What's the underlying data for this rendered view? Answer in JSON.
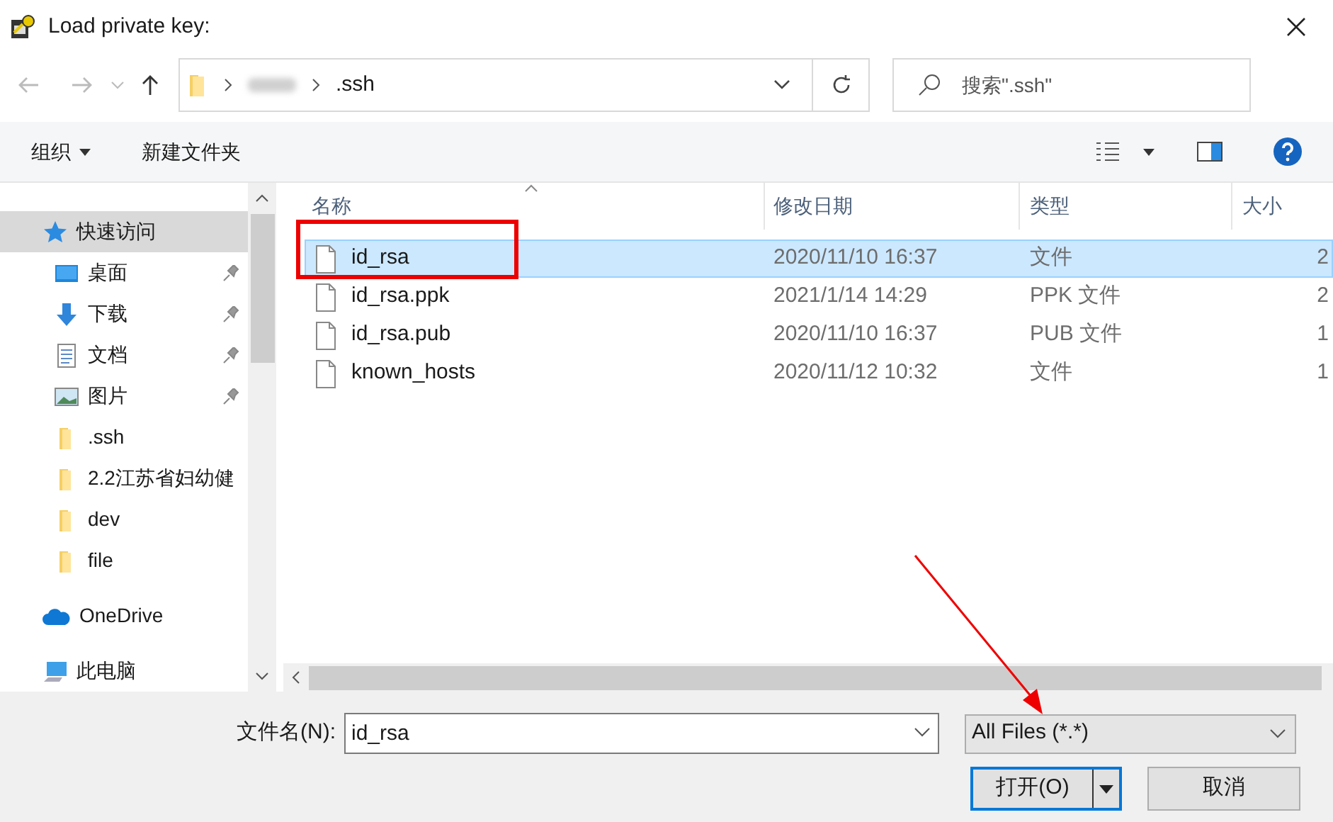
{
  "window": {
    "title": "Load private key:"
  },
  "address_bar": {
    "path": [
      ".ssh"
    ]
  },
  "search": {
    "placeholder": "搜索\".ssh\""
  },
  "toolbar": {
    "organize": "组织",
    "new_folder": "新建文件夹"
  },
  "sidebar": {
    "items": [
      {
        "label": "快速访问",
        "kind": "quick-access",
        "selected": true,
        "pinned": false
      },
      {
        "label": "桌面",
        "kind": "desktop",
        "selected": false,
        "pinned": true
      },
      {
        "label": "下载",
        "kind": "download",
        "selected": false,
        "pinned": true
      },
      {
        "label": "文档",
        "kind": "document",
        "selected": false,
        "pinned": true
      },
      {
        "label": "图片",
        "kind": "pictures",
        "selected": false,
        "pinned": true
      },
      {
        "label": ".ssh",
        "kind": "folder",
        "selected": false,
        "pinned": false
      },
      {
        "label": "2.2江苏省妇幼健",
        "kind": "folder",
        "selected": false,
        "pinned": false
      },
      {
        "label": "dev",
        "kind": "folder",
        "selected": false,
        "pinned": false
      },
      {
        "label": "file",
        "kind": "folder",
        "selected": false,
        "pinned": false
      },
      {
        "label": "OneDrive",
        "kind": "cloud",
        "selected": false,
        "pinned": false
      },
      {
        "label": "此电脑",
        "kind": "computer",
        "selected": false,
        "pinned": false
      }
    ]
  },
  "table": {
    "columns": [
      {
        "label": "名称",
        "sorted": true
      },
      {
        "label": "修改日期",
        "sorted": false
      },
      {
        "label": "类型",
        "sorted": false
      },
      {
        "label": "大小",
        "sorted": false
      }
    ],
    "rows": [
      {
        "name": "id_rsa",
        "date": "2020/11/10 16:37",
        "type": "文件",
        "size": "2",
        "selected": true
      },
      {
        "name": "id_rsa.ppk",
        "date": "2021/1/14 14:29",
        "type": "PPK 文件",
        "size": "2",
        "selected": false
      },
      {
        "name": "id_rsa.pub",
        "date": "2020/11/10 16:37",
        "type": "PUB 文件",
        "size": "1",
        "selected": false
      },
      {
        "name": "known_hosts",
        "date": "2020/11/12 10:32",
        "type": "文件",
        "size": "1",
        "selected": false
      }
    ]
  },
  "footer": {
    "filename_label": "文件名(N):",
    "filename": "id_rsa",
    "filter": "All Files (*.*)",
    "open": "打开(O)",
    "cancel": "取消"
  }
}
